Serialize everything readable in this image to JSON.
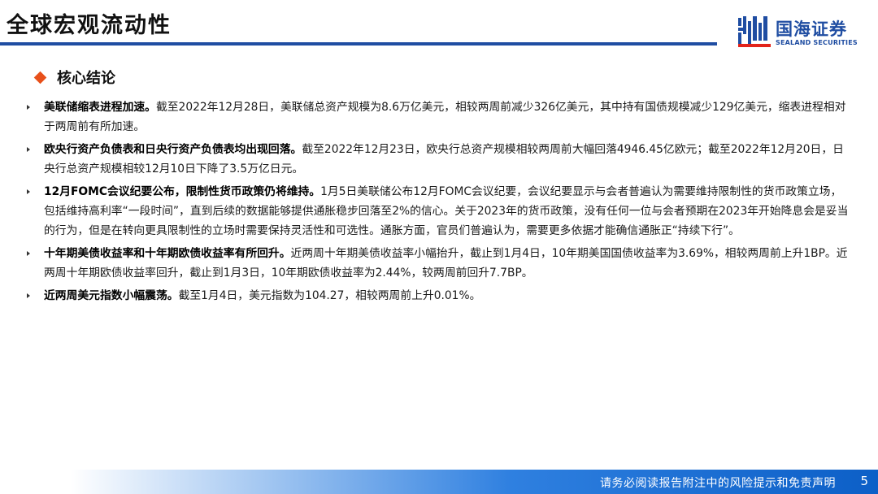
{
  "header": {
    "title": "全球宏观流动性",
    "logo_cn": "国海证券",
    "logo_en": "SEALAND SECURITIES",
    "accent_color": "#1f4da2"
  },
  "section": {
    "heading": "核心结论",
    "bullet_color": "#e8501a"
  },
  "bullets": [
    {
      "lead": "美联储缩表进程加速。",
      "body": "截至2022年12月28日，美联储总资产规模为8.6万亿美元，相较两周前减少326亿美元，其中持有国债规模减少129亿美元，缩表进程相对于两周前有所加速。"
    },
    {
      "lead": "欧央行资产负债表和日央行资产负债表均出现回落。",
      "body": "截至2022年12月23日，欧央行总资产规模相较两周前大幅回落4946.45亿欧元；截至2022年12月20日，日央行总资产规模相较12月10日下降了3.5万亿日元。"
    },
    {
      "lead": "12月FOMC会议纪要公布，限制性货币政策仍将维持。",
      "body": "1月5日美联储公布12月FOMC会议纪要，会议纪要显示与会者普遍认为需要维持限制性的货币政策立场，包括维持高利率“一段时间”，直到后续的数据能够提供通胀稳步回落至2%的信心。关于2023年的货币政策，没有任何一位与会者预期在2023年开始降息会是妥当的行为，但是在转向更具限制性的立场时需要保持灵活性和可选性。通胀方面，官员们普遍认为，需要更多依据才能确信通胀正“持续下行”。"
    },
    {
      "lead": "十年期美债收益率和十年期欧债收益率有所回升。",
      "body": "近两周十年期美债收益率小幅抬升，截止到1月4日，10年期美国国债收益率为3.69%，相较两周前上升1BP。近两周十年期欧债收益率回升，截止到1月3日，10年期欧债收益率为2.44%，较两周前回升7.7BP。"
    },
    {
      "lead": "近两周美元指数小幅震荡。",
      "body": "截至1月4日，美元指数为104.27，相较两周前上升0.01%。"
    }
  ],
  "footer": {
    "disclaimer": "请务必阅读报告附注中的风险提示和免责声明",
    "page_number": "5"
  }
}
